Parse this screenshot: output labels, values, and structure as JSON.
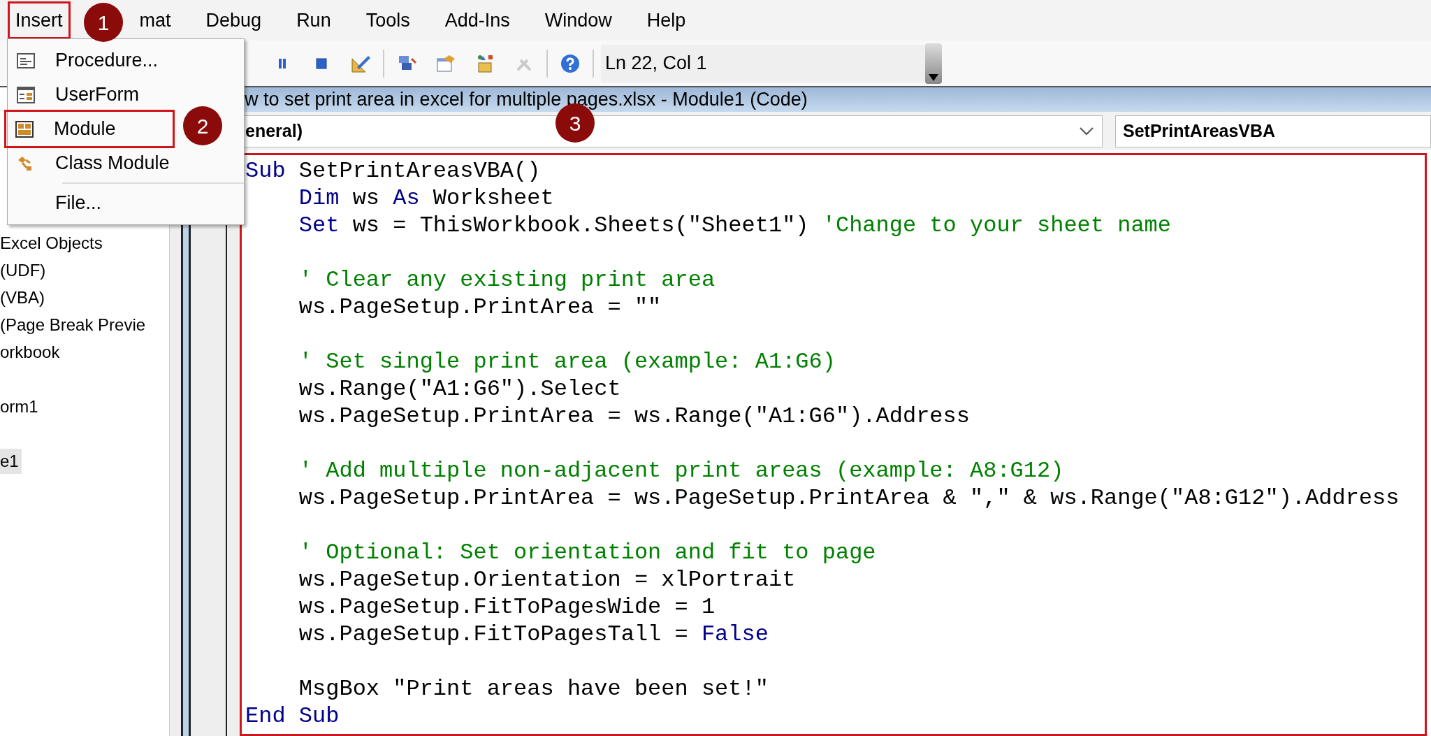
{
  "menu_bar": {
    "items": [
      {
        "label": "Insert",
        "selected": true
      },
      {
        "label": "mat",
        "selected": false
      },
      {
        "label": "Debug",
        "selected": false
      },
      {
        "label": "Run",
        "selected": false
      },
      {
        "label": "Tools",
        "selected": false
      },
      {
        "label": "Add-Ins",
        "selected": false
      },
      {
        "label": "Window",
        "selected": false
      },
      {
        "label": "Help",
        "selected": false
      }
    ]
  },
  "insert_menu": {
    "items": [
      {
        "label": "Procedure...",
        "kind": "procedure",
        "selected": false
      },
      {
        "label": "UserForm",
        "kind": "userform",
        "selected": false
      },
      {
        "label": "Module",
        "kind": "module",
        "selected": true
      },
      {
        "label": "Class Module",
        "kind": "class",
        "selected": false
      },
      {
        "label": "File...",
        "kind": "file",
        "selected": false
      }
    ]
  },
  "toolbar": {
    "buttons": [
      {
        "kind": "pause",
        "disabled": false
      },
      {
        "kind": "stop",
        "disabled": false
      },
      {
        "kind": "design",
        "disabled": false
      },
      {
        "kind": "explorer",
        "disabled": false
      },
      {
        "kind": "properties",
        "disabled": false
      },
      {
        "kind": "browser",
        "disabled": false
      },
      {
        "kind": "toolbox",
        "disabled": true
      },
      {
        "kind": "help",
        "disabled": false
      }
    ],
    "position": "Ln 22, Col 1"
  },
  "project_tree": {
    "groups": [
      {
        "items": [
          {
            "label": "Excel Objects",
            "selected": false
          },
          {
            "label": "(UDF)",
            "selected": false
          },
          {
            "label": "(VBA)",
            "selected": false
          },
          {
            "label": "(Page Break Previe",
            "selected": false
          },
          {
            "label": "orkbook",
            "selected": false
          }
        ]
      },
      {
        "items": [
          {
            "label": "orm1",
            "selected": false
          }
        ]
      },
      {
        "items": [
          {
            "label": "e1",
            "selected": true
          }
        ]
      }
    ]
  },
  "code_window": {
    "title": "w to set print area in excel for multiple pages.xlsx - Module1 (Code)",
    "object_combo": "eneral)",
    "procedure_combo": "SetPrintAreasVBA",
    "lines": [
      {
        "kind": "code",
        "indented": false,
        "segments": [
          {
            "kind": "keyword",
            "text": "Sub"
          },
          {
            "kind": "plain",
            "text": " SetPrintAreasVBA()"
          }
        ]
      },
      {
        "kind": "code",
        "indented": true,
        "segments": [
          {
            "kind": "keyword",
            "text": "Dim"
          },
          {
            "kind": "plain",
            "text": " ws "
          },
          {
            "kind": "keyword",
            "text": "As"
          },
          {
            "kind": "plain",
            "text": " Worksheet"
          }
        ]
      },
      {
        "kind": "code",
        "indented": true,
        "segments": [
          {
            "kind": "keyword",
            "text": "Set"
          },
          {
            "kind": "plain",
            "text": " ws = ThisWorkbook.Sheets(\"Sheet1\") "
          },
          {
            "kind": "comment",
            "text": "'Change to your sheet name"
          }
        ]
      },
      {
        "kind": "blank"
      },
      {
        "kind": "code",
        "indented": true,
        "segments": [
          {
            "kind": "comment",
            "text": "' Clear any existing print area"
          }
        ]
      },
      {
        "kind": "code",
        "indented": true,
        "segments": [
          {
            "kind": "plain",
            "text": "ws.PageSetup.PrintArea = \"\""
          }
        ]
      },
      {
        "kind": "blank"
      },
      {
        "kind": "code",
        "indented": true,
        "segments": [
          {
            "kind": "comment",
            "text": "' Set single print area (example: A1:G6)"
          }
        ]
      },
      {
        "kind": "code",
        "indented": true,
        "segments": [
          {
            "kind": "plain",
            "text": "ws.Range(\"A1:G6\").Select"
          }
        ]
      },
      {
        "kind": "code",
        "indented": true,
        "segments": [
          {
            "kind": "plain",
            "text": "ws.PageSetup.PrintArea = ws.Range(\"A1:G6\").Address"
          }
        ]
      },
      {
        "kind": "blank"
      },
      {
        "kind": "code",
        "indented": true,
        "segments": [
          {
            "kind": "comment",
            "text": "' Add multiple non-adjacent print areas (example: A8:G12)"
          }
        ]
      },
      {
        "kind": "code",
        "indented": true,
        "segments": [
          {
            "kind": "plain",
            "text": "ws.PageSetup.PrintArea = ws.PageSetup.PrintArea & \",\" & ws.Range(\"A8:G12\").Address"
          }
        ]
      },
      {
        "kind": "blank"
      },
      {
        "kind": "code",
        "indented": true,
        "segments": [
          {
            "kind": "comment",
            "text": "' Optional: Set orientation and fit to page"
          }
        ]
      },
      {
        "kind": "code",
        "indented": true,
        "segments": [
          {
            "kind": "plain",
            "text": "ws.PageSetup.Orientation = xlPortrait"
          }
        ]
      },
      {
        "kind": "code",
        "indented": true,
        "segments": [
          {
            "kind": "plain",
            "text": "ws.PageSetup.FitToPagesWide = 1"
          }
        ]
      },
      {
        "kind": "code",
        "indented": true,
        "segments": [
          {
            "kind": "plain",
            "text": "ws.PageSetup.FitToPagesTall = "
          },
          {
            "kind": "keyword",
            "text": "False"
          }
        ]
      },
      {
        "kind": "blank"
      },
      {
        "kind": "code",
        "indented": true,
        "segments": [
          {
            "kind": "plain",
            "text": "MsgBox \"Print areas have been set!\""
          }
        ]
      },
      {
        "kind": "code",
        "indented": false,
        "segments": [
          {
            "kind": "keyword",
            "text": "End Sub"
          }
        ]
      }
    ]
  },
  "step_badges": [
    "1",
    "2",
    "3"
  ]
}
